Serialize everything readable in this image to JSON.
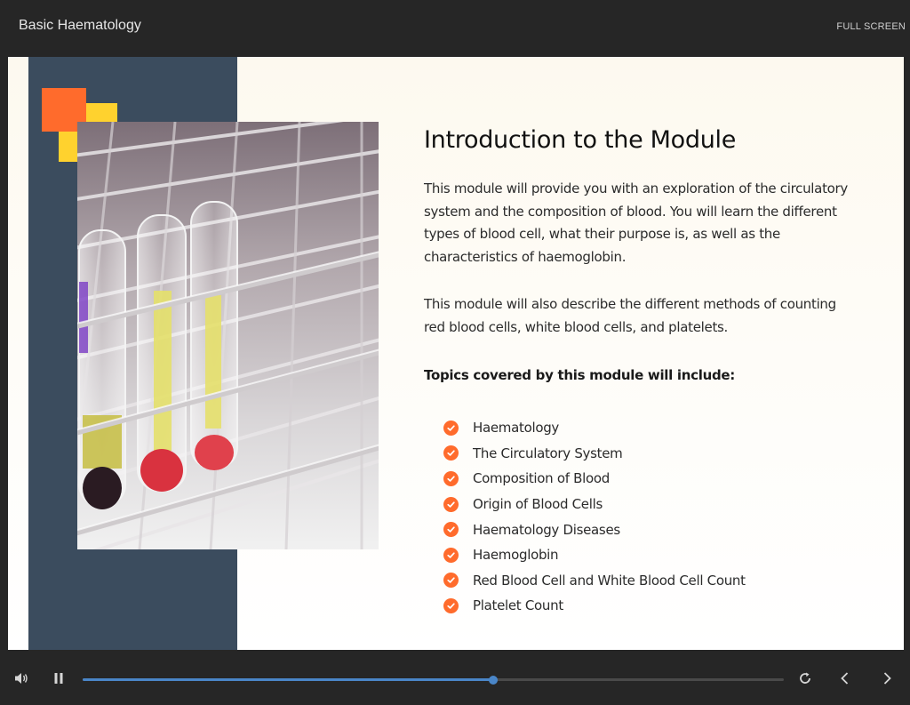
{
  "header": {
    "course_title": "Basic Haematology",
    "fullscreen_label": "FULL SCREEN"
  },
  "slide": {
    "heading": "Introduction to the Module",
    "paragraph_1": "This module will provide you with an exploration of the circulatory system and the composition of blood. You will learn the different types of blood cell, what their purpose is, as well as the characteristics of haemoglobin.",
    "paragraph_2": "This module will also describe the different methods of counting red blood cells, white blood cells, and platelets.",
    "topics_label": "Topics covered by this module will include:",
    "topics": [
      "Haematology",
      "The Circulatory System",
      "Composition of Blood",
      "Origin of Blood Cells",
      "Haematology Diseases",
      "Haemoglobin",
      "Red Blood Cell and White Blood Cell Count",
      "Platelet Count"
    ],
    "accent_colors": {
      "navy": "#3b4c5e",
      "orange": "#ff6b2c",
      "yellow": "#ffd22e"
    }
  },
  "player": {
    "progress": 0.586,
    "accent": "#4a86c8",
    "icons": [
      "volume-icon",
      "pause-icon",
      "replay-icon",
      "chevron-left-icon",
      "chevron-right-icon"
    ]
  }
}
